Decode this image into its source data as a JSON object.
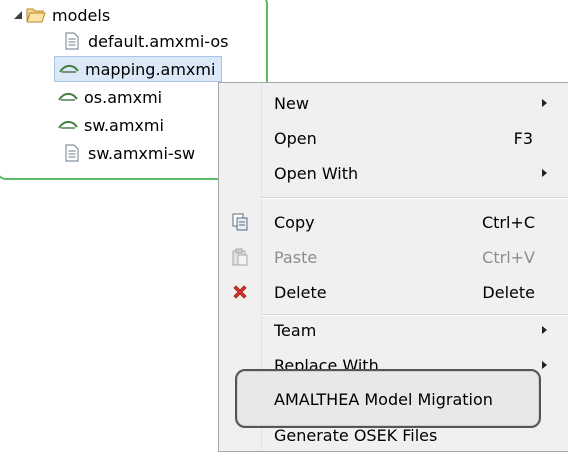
{
  "tree": {
    "folder": "models",
    "files": [
      {
        "label": "default.amxmi-os",
        "icon": "text-file-icon"
      },
      {
        "label": "mapping.amxmi",
        "icon": "amalthea-model-icon",
        "selected": true
      },
      {
        "label": "os.amxmi",
        "icon": "amalthea-model-icon"
      },
      {
        "label": "sw.amxmi",
        "icon": "amalthea-model-icon"
      },
      {
        "label": "sw.amxmi-sw",
        "icon": "text-file-icon"
      }
    ]
  },
  "menu": {
    "new": "New",
    "open": "Open",
    "open_shortcut": "F3",
    "open_with": "Open With",
    "copy": "Copy",
    "copy_shortcut": "Ctrl+C",
    "paste": "Paste",
    "paste_shortcut": "Ctrl+V",
    "delete": "Delete",
    "delete_shortcut": "Delete",
    "team": "Team",
    "replace_with": "Replace With",
    "migration": "AMALTHEA Model Migration",
    "generate": "Generate OSEK Files"
  },
  "colors": {
    "tree_border": "#5dbb63",
    "selection": "#dbe8f8",
    "menu_bg": "#f0f0f0",
    "delete_icon": "#d9322b"
  }
}
